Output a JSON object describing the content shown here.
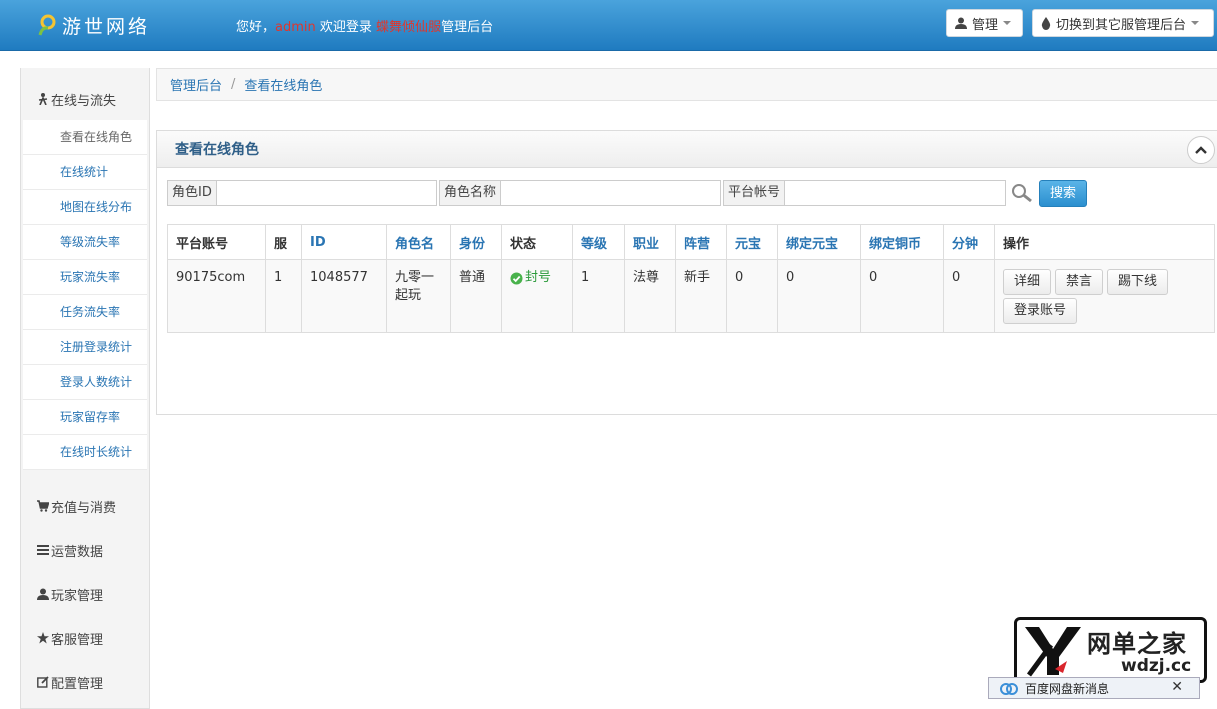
{
  "header": {
    "logo_text": "游世网络",
    "greeting": "您好，",
    "username": "admin",
    "welcome": "欢迎登录",
    "server_name": "蝶舞倾仙",
    "server_suffix": "服",
    "admin_suffix": "管理后台",
    "manage_label": "管理",
    "switch_label": "切换到其它服管理后台"
  },
  "sidebar": {
    "group_online": "在线与流失",
    "items": [
      {
        "label": "查看在线角色"
      },
      {
        "label": "在线统计"
      },
      {
        "label": "地图在线分布"
      },
      {
        "label": "等级流失率"
      },
      {
        "label": "玩家流失率"
      },
      {
        "label": "任务流失率"
      },
      {
        "label": "注册登录统计"
      },
      {
        "label": "登录人数统计"
      },
      {
        "label": "玩家留存率"
      },
      {
        "label": "在线时长统计"
      }
    ],
    "group_recharge": "充值与消费",
    "group_ops": "运营数据",
    "group_player": "玩家管理",
    "group_service": "客服管理",
    "group_config": "配置管理"
  },
  "breadcrumb": {
    "home": "管理后台",
    "separator": "/",
    "current": "查看在线角色"
  },
  "panel": {
    "title": "查看在线角色"
  },
  "search": {
    "role_id_label": "角色ID",
    "role_id_value": "",
    "role_name_label": "角色名称",
    "role_name_value": "",
    "account_label": "平台帐号",
    "account_value": "",
    "button_label": "搜索"
  },
  "table": {
    "headers": [
      "平台账号",
      "服",
      "ID",
      "角色名",
      "身份",
      "状态",
      "等级",
      "职业",
      "阵营",
      "元宝",
      "绑定元宝",
      "绑定铜币",
      "分钟",
      "操作"
    ],
    "row": {
      "account": "90175com",
      "server": "1",
      "id": "1048577",
      "name": "九零一起玩",
      "identity": "普通",
      "status": "封号",
      "level": "1",
      "job": "法尊",
      "camp": "新手",
      "yuanbao": "0",
      "bound_yuanbao": "0",
      "bound_copper": "0",
      "minutes": "0"
    },
    "actions": {
      "detail": "详细",
      "mute": "禁言",
      "kick": "踢下线",
      "login": "登录账号"
    }
  },
  "watermark": {
    "text": "网单之家",
    "url": "wdzj.cc"
  },
  "notification": {
    "text": "百度网盘新消息",
    "close": "✕"
  },
  "colors": {
    "header_blue": "#2b8bd0",
    "link_blue": "#2a75b3",
    "status_green": "#2a9a3a",
    "username_red": "#e0362c"
  }
}
